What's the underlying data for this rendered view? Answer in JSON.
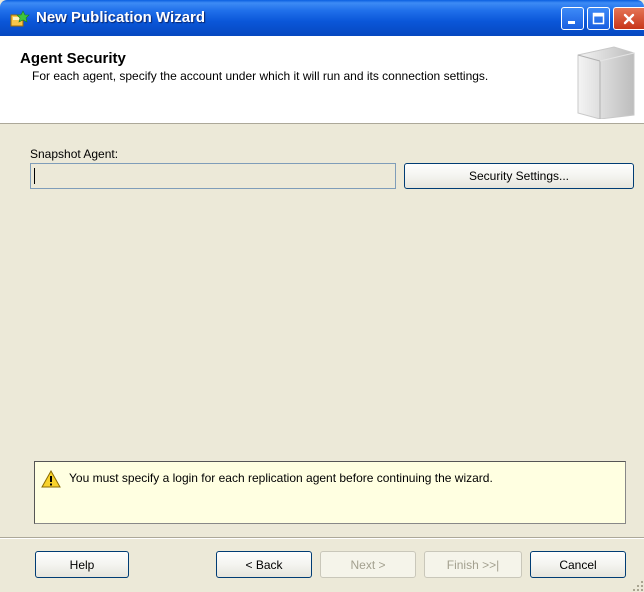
{
  "window": {
    "title": "New Publication Wizard",
    "icon": "wizard-app-icon",
    "controls": [
      "minimize-icon",
      "maximize-icon",
      "close-icon"
    ]
  },
  "header": {
    "title": "Agent Security",
    "description": "For each agent, specify the account under which it will run and its connection settings."
  },
  "snapshot_agent": {
    "label": "Snapshot Agent:",
    "value": "",
    "security_button": "Security Settings..."
  },
  "warning": {
    "icon": "warning-icon",
    "message": "You must specify a login for each replication agent before continuing the wizard."
  },
  "footer": {
    "help": "Help",
    "back": "< Back",
    "next": "Next >",
    "finish": "Finish >>|",
    "cancel": "Cancel"
  }
}
